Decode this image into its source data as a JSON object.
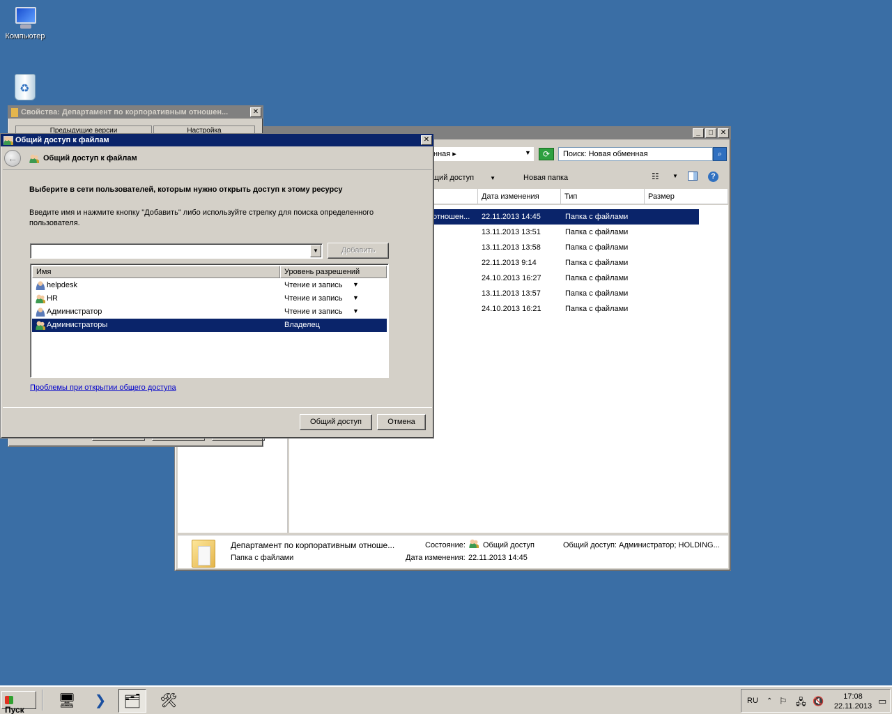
{
  "desktop": {
    "computer_label": "Компьютер"
  },
  "explorer": {
    "address_segment": "нная",
    "search_placeholder": "Поиск: Новая обменная",
    "toolbar": {
      "share_label": "щий доступ",
      "new_folder_label": "Новая папка"
    },
    "columns": {
      "date": "Дата изменения",
      "type": "Тип",
      "size": "Размер"
    },
    "rows": [
      {
        "name": "отношен...",
        "date": "22.11.2013 14:45",
        "type": "Папка с файлами"
      },
      {
        "name": "",
        "date": "13.11.2013 13:51",
        "type": "Папка с файлами"
      },
      {
        "name": "",
        "date": "13.11.2013 13:58",
        "type": "Папка с файлами"
      },
      {
        "name": "",
        "date": "22.11.2013 9:14",
        "type": "Папка с файлами"
      },
      {
        "name": "",
        "date": "24.10.2013 16:27",
        "type": "Папка с файлами"
      },
      {
        "name": "",
        "date": "13.11.2013 13:57",
        "type": "Папка с файлами"
      },
      {
        "name": "",
        "date": "24.10.2013 16:21",
        "type": "Папка с файлами"
      }
    ],
    "details": {
      "name": "Департамент по корпоративным отноше...",
      "kind": "Папка с файлами",
      "state_label": "Состояние:",
      "state_value": "Общий доступ",
      "modified_label": "Дата изменения:",
      "modified_value": "22.11.2013 14:45",
      "shared_label": "Общий доступ: Администратор; HOLDING..."
    }
  },
  "props": {
    "title": "Свойства: Департамент по корпоративным отношен...",
    "tab1": "Предыдущие версии",
    "tab2": "Настройка"
  },
  "share": {
    "title": "Общий доступ к файлам",
    "nav_title": "Общий доступ к файлам",
    "heading": "Выберите в сети пользователей, которым нужно открыть доступ к этому ресурсу",
    "instructions": "Введите имя и нажмите кнопку \"Добавить\" либо используйте стрелку для поиска определенного пользователя.",
    "input_value": "",
    "add_label": "Добавить",
    "col_name": "Имя",
    "col_level": "Уровень разрешений",
    "users": [
      {
        "name": "helpdesk",
        "level": "Чтение и запись"
      },
      {
        "name": "HR",
        "level": "Чтение и запись"
      },
      {
        "name": "Администратор",
        "level": "Чтение и запись"
      },
      {
        "name": "Администраторы",
        "level": "Владелец"
      }
    ],
    "help_link": "Проблемы при открытии общего доступа",
    "share_button": "Общий доступ",
    "cancel_button": "Отмена"
  },
  "taskbar": {
    "start_label": "Пуск",
    "lang": "RU",
    "time": "17:08",
    "date": "22.11.2013"
  }
}
